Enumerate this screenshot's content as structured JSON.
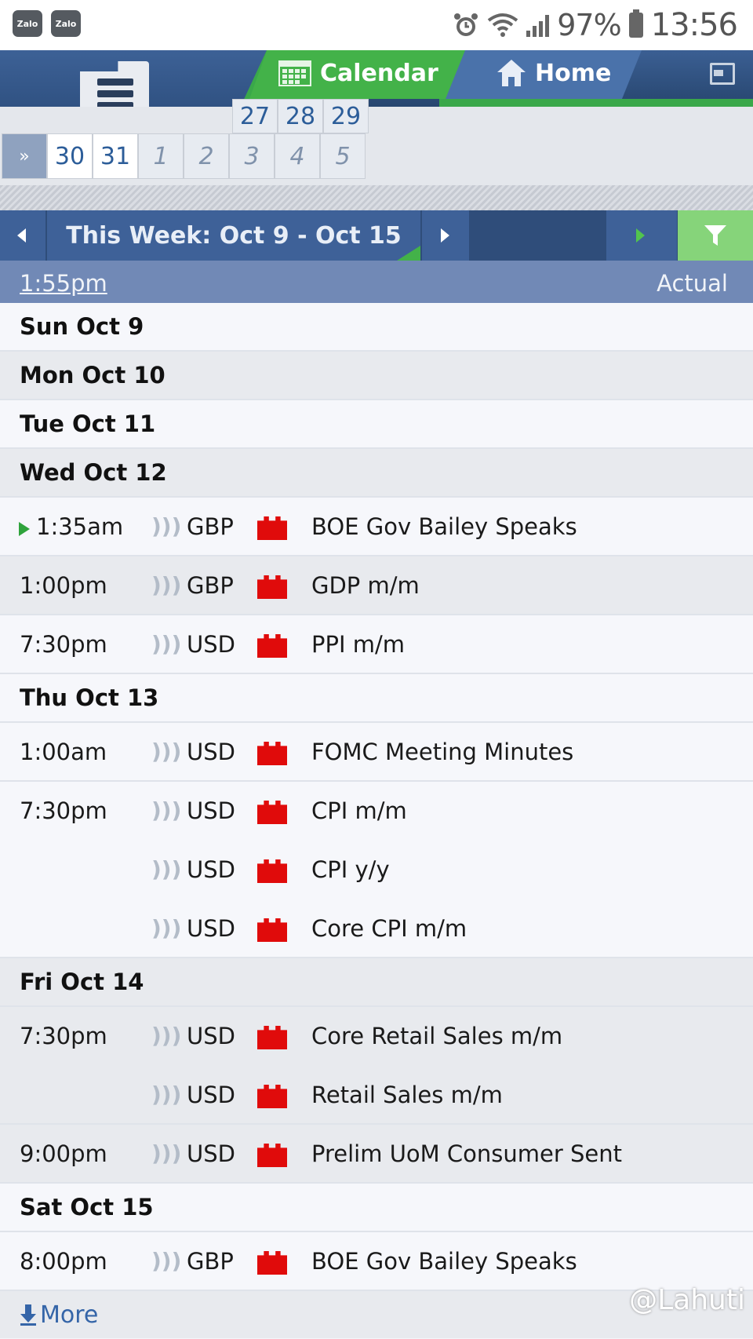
{
  "status_bar": {
    "app1": "Zalo",
    "app2": "Zalo",
    "battery": "97%",
    "time": "13:56"
  },
  "header": {
    "tab_calendar": "Calendar",
    "tab_home": "Home"
  },
  "mini_calendar": {
    "row1": [
      "27",
      "28",
      "29"
    ],
    "row2": [
      "30",
      "31",
      "1",
      "2",
      "3",
      "4",
      "5"
    ],
    "expand": "»"
  },
  "week_nav": {
    "title": "This Week: Oct 9 - Oct 15"
  },
  "column_header": {
    "time": "1:55pm",
    "actual": "Actual"
  },
  "days": [
    {
      "label": "Sun Oct 9",
      "events": []
    },
    {
      "label": "Mon Oct 10",
      "events": []
    },
    {
      "label": "Tue Oct 11",
      "events": []
    },
    {
      "label": "Wed Oct 12",
      "events": [
        {
          "time": "1:35am",
          "currency": "GBP",
          "name": "BOE Gov Bailey Speaks",
          "current": true
        },
        {
          "time": "1:00pm",
          "currency": "GBP",
          "name": "GDP m/m"
        },
        {
          "time": "7:30pm",
          "currency": "USD",
          "name": "PPI m/m"
        }
      ]
    },
    {
      "label": "Thu Oct 13",
      "events": [
        {
          "time": "1:00am",
          "currency": "USD",
          "name": "FOMC Meeting Minutes"
        },
        {
          "time": "7:30pm",
          "currency": "USD",
          "name": "CPI m/m"
        },
        {
          "time": "",
          "currency": "USD",
          "name": "CPI y/y"
        },
        {
          "time": "",
          "currency": "USD",
          "name": "Core CPI m/m"
        }
      ]
    },
    {
      "label": "Fri Oct 14",
      "events": [
        {
          "time": "7:30pm",
          "currency": "USD",
          "name": "Core Retail Sales m/m"
        },
        {
          "time": "",
          "currency": "USD",
          "name": "Retail Sales m/m"
        },
        {
          "time": "9:00pm",
          "currency": "USD",
          "name": "Prelim UoM Consumer Sent"
        }
      ]
    },
    {
      "label": "Sat Oct 15",
      "events": [
        {
          "time": "8:00pm",
          "currency": "GBP",
          "name": "BOE Gov Bailey Speaks"
        }
      ]
    }
  ],
  "more_label": "More",
  "watermark": "@Lahuti",
  "icons": {
    "impact": "red-impact-icon",
    "speaker": "sound-icon"
  },
  "colors": {
    "accent_green": "#43b249",
    "header_blue": "#3e6198",
    "impact_red": "#e00b0b"
  }
}
